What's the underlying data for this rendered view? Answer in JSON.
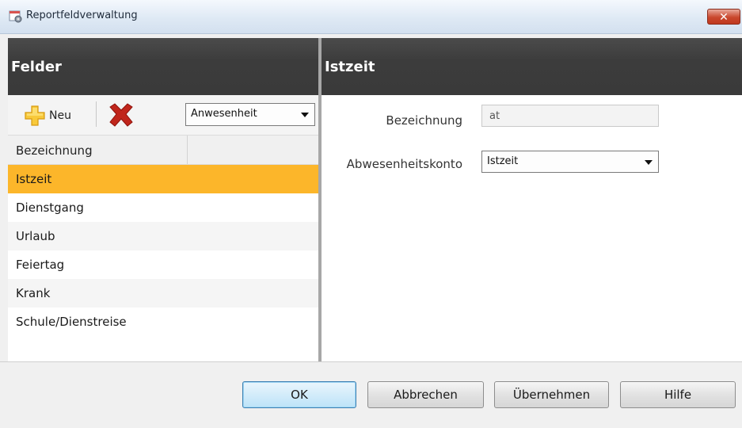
{
  "window": {
    "title": "Reportfeldverwaltung",
    "close_glyph": "✕",
    "title_icon": "gear-document-icon"
  },
  "left": {
    "header": "Felder",
    "toolbar": {
      "new_label": "Neu",
      "new_icon": "plus-icon",
      "delete_icon": "delete-x-icon",
      "category_value": "Anwesenheit"
    },
    "table": {
      "column": "Bezeichnung",
      "rows": [
        "Istzeit",
        "Dienstgang",
        "Urlaub",
        "Feiertag",
        "Krank",
        "Schule/Dienstreise"
      ],
      "selected": "Istzeit"
    }
  },
  "right": {
    "header": "Istzeit",
    "fields": {
      "bezeichnung_label": "Bezeichnung",
      "bezeichnung_value": "at",
      "konto_label": "Abwesenheitskonto",
      "konto_value": "Istzeit"
    }
  },
  "footer": {
    "ok": "OK",
    "cancel": "Abbrechen",
    "apply": "Übernehmen",
    "help": "Hilfe"
  },
  "colors": {
    "header_bg": "#3e3e3e",
    "selection": "#fcb62a",
    "default_button": "#cde8f8"
  }
}
